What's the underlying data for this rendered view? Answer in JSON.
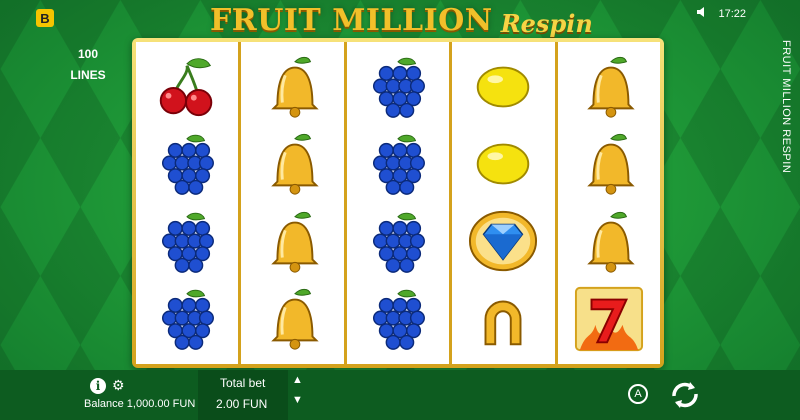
{
  "brand": {
    "badge": "B"
  },
  "title": {
    "main": "FRUIT MILLION",
    "sub": "Respin"
  },
  "status": {
    "sound_icon": "speaker-icon",
    "time": "17:22"
  },
  "side_label": "FRUIT MILLION RESPIN",
  "lines": {
    "count": "100",
    "label": "LINES"
  },
  "reels": [
    [
      "cherry",
      "grape",
      "grape",
      "grape"
    ],
    [
      "bell",
      "bell",
      "bell",
      "bell"
    ],
    [
      "grape",
      "grape",
      "grape",
      "grape"
    ],
    [
      "lemon",
      "lemon",
      "diamond",
      "horseshoe"
    ],
    [
      "bell",
      "bell",
      "bell",
      "seven"
    ]
  ],
  "footer": {
    "info_glyph": "i",
    "balance": "Balance 1,000.00 FUN",
    "total_bet_label": "Total bet",
    "total_bet_value": "2.00 FUN",
    "autoplay_glyph": "A"
  },
  "colors": {
    "background": "#1f9a38",
    "frame": "#d4a21c",
    "footer": "#0d5c20"
  }
}
